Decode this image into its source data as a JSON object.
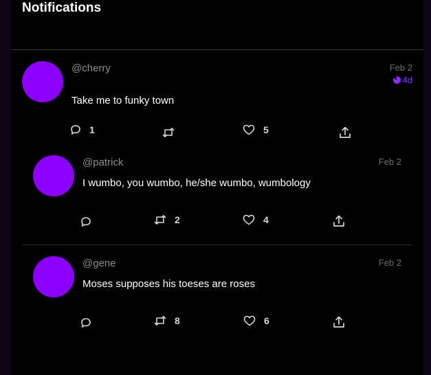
{
  "header": {
    "title": "Notifications"
  },
  "posts": [
    {
      "handle": "@cherry",
      "date": "Feb 2",
      "age": "4d",
      "text": "Take me to funky town",
      "replies": "1",
      "reposts": "",
      "likes": "5"
    },
    {
      "handle": "@patrick",
      "date": "Feb 2",
      "text": "I wumbo, you wumbo, he/she wumbo, wumbology",
      "replies": "",
      "reposts": "2",
      "likes": "4"
    },
    {
      "handle": "@gene",
      "date": "Feb 2",
      "text": "Moses supposes his toeses are roses",
      "replies": "",
      "reposts": "8",
      "likes": "6"
    }
  ],
  "colors": {
    "avatar": "#8b00ff",
    "accent": "#8b2cff",
    "background": "#000000",
    "outer_background": "#0e0616"
  },
  "icons": {
    "reply": "reply-icon",
    "repost": "repost-icon",
    "like": "heart-icon",
    "share": "share-icon",
    "age": "drop-icon"
  }
}
